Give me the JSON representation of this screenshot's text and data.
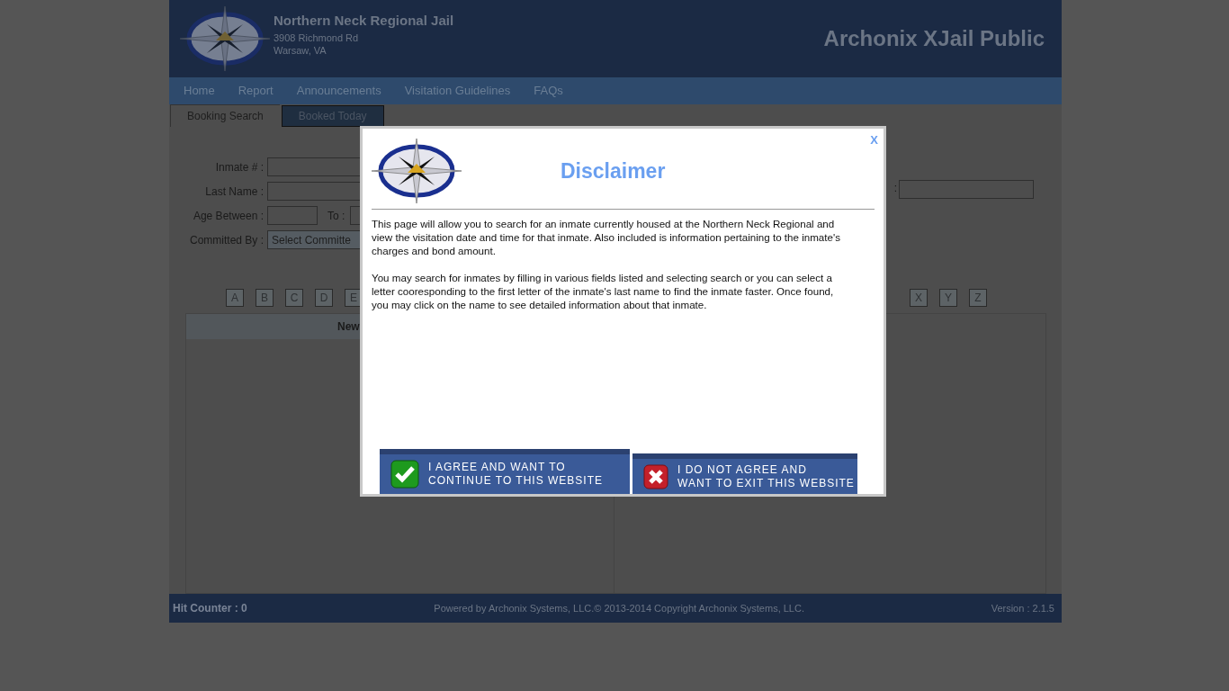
{
  "header": {
    "title": "Northern Neck Regional Jail",
    "address": [
      "3908 Richmond Rd",
      "Warsaw, VA"
    ],
    "app_title": "Archonix XJail Public"
  },
  "nav": [
    {
      "label": "Home"
    },
    {
      "label": "Report"
    },
    {
      "label": "Announcements"
    },
    {
      "label": "Visitation Guidelines"
    },
    {
      "label": "FAQs"
    }
  ],
  "tabs": [
    {
      "label": "Booking Search",
      "selected": true
    },
    {
      "label": "Booked Today",
      "selected": false
    }
  ],
  "form": {
    "fields": [
      {
        "kind": "input",
        "label": "Inmate # :"
      },
      {
        "kind": "input",
        "label": "Last Name :"
      },
      {
        "kind": "range",
        "label": "Age Between :",
        "to_label": "To :"
      },
      {
        "kind": "select",
        "label": "Committed By :",
        "value": "Select Committe"
      }
    ],
    "right_field": {
      "label": ":"
    }
  },
  "letters_left": [
    "A",
    "B",
    "C",
    "D",
    "E"
  ],
  "letters_right": [
    "X",
    "Y",
    "Z"
  ],
  "table": {
    "column_1": "New"
  },
  "footer": {
    "hit_counter": "Hit Counter : 0",
    "powered": "Powered by Archonix Systems, LLC.© 2013-2014 Copyright Archonix Systems, LLC.",
    "version": "Version : 2.1.5"
  },
  "dialog": {
    "title": "Disclaimer",
    "close": "X",
    "paragraphs": [
      "This page will allow you to search for an inmate currently housed at the Northern Neck Regional and view the visitation date and time for that inmate. Also included is information pertaining to the inmate's charges and bond amount.",
      "You may search for inmates by filling in various fields listed and selecting search or you can select a letter cooresponding to the first letter of the inmate's last name to find the inmate faster. Once found, you may click on the name to see detailed information about that inmate."
    ],
    "buttons": [
      {
        "kind": "agree",
        "lines": [
          "I AGREE AND WANT TO",
          "CONTINUE TO THIS WEBSITE"
        ]
      },
      {
        "kind": "disagree",
        "lines": [
          "I DO NOT AGREE AND",
          "WANT TO EXIT THIS WEBSITE"
        ]
      }
    ]
  }
}
